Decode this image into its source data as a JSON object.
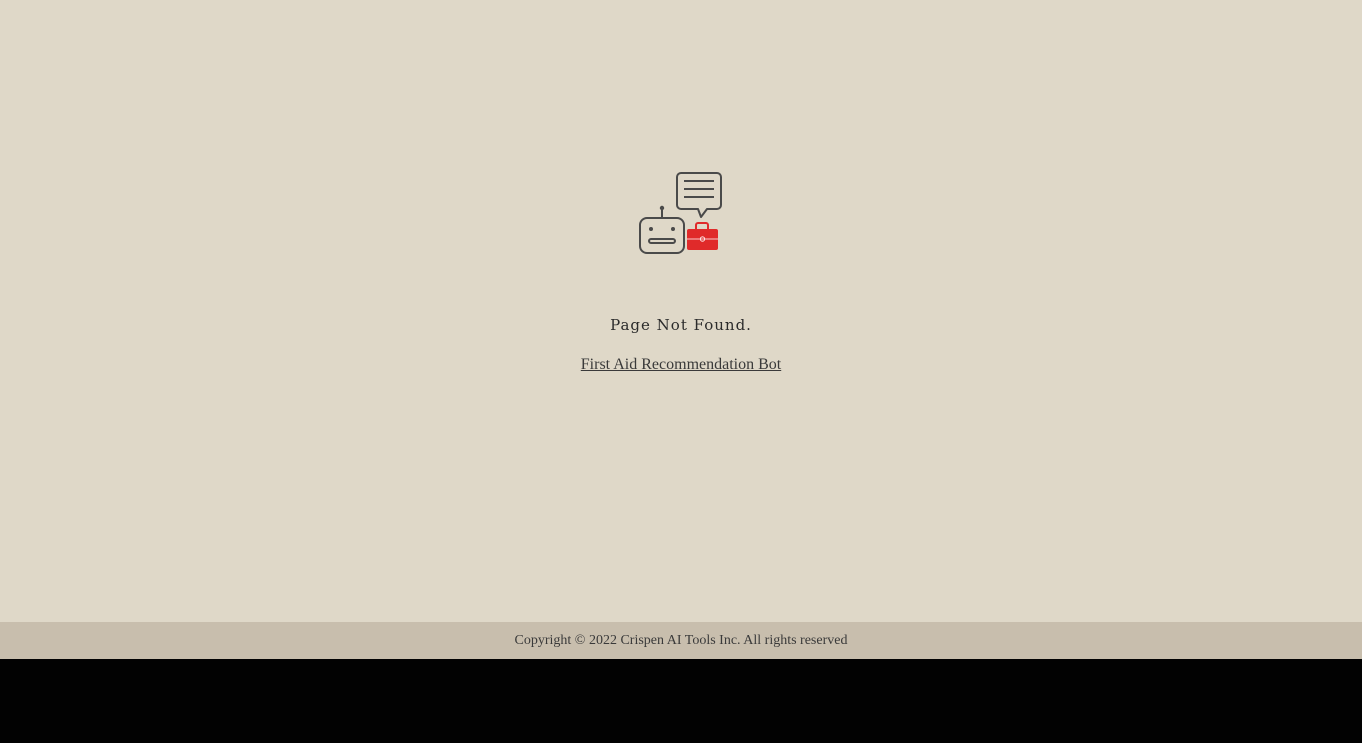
{
  "colors": {
    "background": "#dfd8c8",
    "footer_background": "#c8bead",
    "accent": "#e02a2a",
    "icon_stroke": "#4a4a4a",
    "text": "#2b2b2b"
  },
  "logo": {
    "icon": "robot-with-chat-bubble-and-first-aid-kit"
  },
  "main": {
    "title": "Page Not Found.",
    "home_link": "First Aid Recommendation Bot"
  },
  "footer": {
    "copyright": "Copyright © 2022 Crispen AI Tools Inc. All rights reserved"
  }
}
